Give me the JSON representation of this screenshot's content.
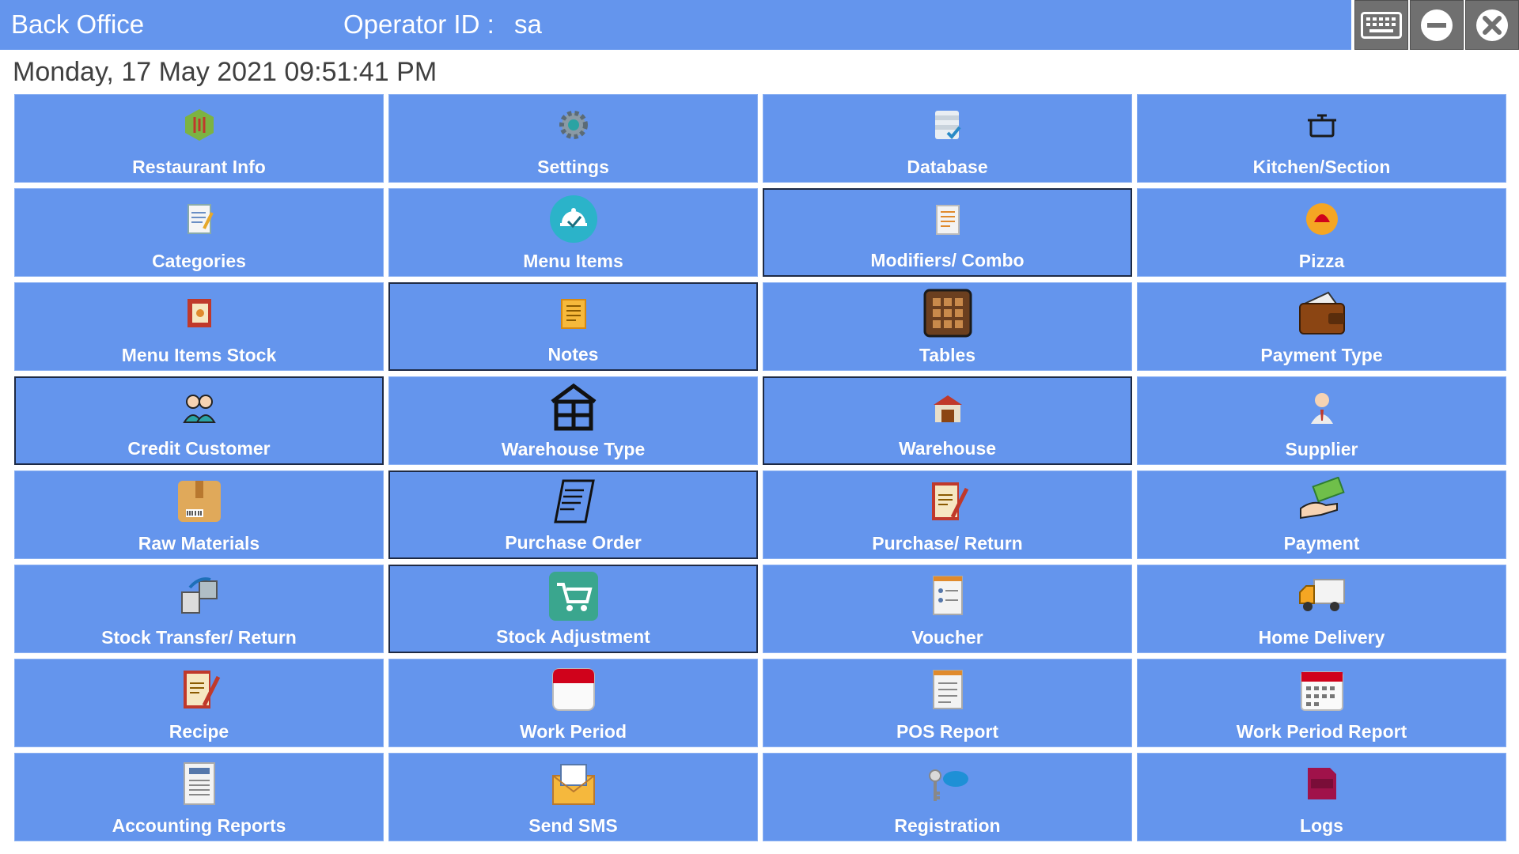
{
  "header": {
    "app_title": "Back Office",
    "operator_label": "Operator ID :",
    "operator_value": "sa"
  },
  "window_controls": {
    "keyboard": "keyboard-icon",
    "minimize": "minimize-icon",
    "close": "close-icon"
  },
  "datetime": "Monday, 17 May 2021 09:51:41 PM",
  "colors": {
    "accent": "#6495ed",
    "control_bg": "#707070"
  },
  "menu_tiles": [
    {
      "label": "Restaurant Info",
      "icon": "restaurant-info-icon"
    },
    {
      "label": "Settings",
      "icon": "gear-icon"
    },
    {
      "label": "Database",
      "icon": "database-icon"
    },
    {
      "label": "Kitchen/Section",
      "icon": "cooking-pot-icon"
    },
    {
      "label": "Categories",
      "icon": "notepad-icon"
    },
    {
      "label": "Menu Items",
      "icon": "cloche-icon"
    },
    {
      "label": "Modifiers/ Combo",
      "icon": "document-icon"
    },
    {
      "label": "Pizza",
      "icon": "pizza-icon"
    },
    {
      "label": "Menu Items Stock",
      "icon": "book-icon"
    },
    {
      "label": "Notes",
      "icon": "notes-icon"
    },
    {
      "label": "Tables",
      "icon": "table-icon"
    },
    {
      "label": "Payment Type",
      "icon": "wallet-icon"
    },
    {
      "label": "Credit Customer",
      "icon": "users-icon"
    },
    {
      "label": "Warehouse Type",
      "icon": "warehouse-type-icon"
    },
    {
      "label": "Warehouse",
      "icon": "warehouse-icon"
    },
    {
      "label": "Supplier",
      "icon": "person-icon"
    },
    {
      "label": "Raw Materials",
      "icon": "box-icon"
    },
    {
      "label": "Purchase Order",
      "icon": "receipt-icon"
    },
    {
      "label": "Purchase/ Return",
      "icon": "signed-document-icon"
    },
    {
      "label": "Payment",
      "icon": "cash-hand-icon"
    },
    {
      "label": "Stock Transfer/ Return",
      "icon": "transfer-icon"
    },
    {
      "label": "Stock Adjustment",
      "icon": "cart-icon"
    },
    {
      "label": "Voucher",
      "icon": "voucher-icon"
    },
    {
      "label": "Home Delivery",
      "icon": "truck-icon"
    },
    {
      "label": "Recipe",
      "icon": "recipe-icon"
    },
    {
      "label": "Work Period",
      "icon": "calendar-blank-icon"
    },
    {
      "label": "POS Report",
      "icon": "report-icon"
    },
    {
      "label": "Work Period Report",
      "icon": "calendar-icon"
    },
    {
      "label": "Accounting Reports",
      "icon": "accounting-icon"
    },
    {
      "label": "Send SMS",
      "icon": "sms-envelope-icon"
    },
    {
      "label": "Registration",
      "icon": "key-icon"
    },
    {
      "label": "Logs",
      "icon": "log-file-icon"
    }
  ]
}
